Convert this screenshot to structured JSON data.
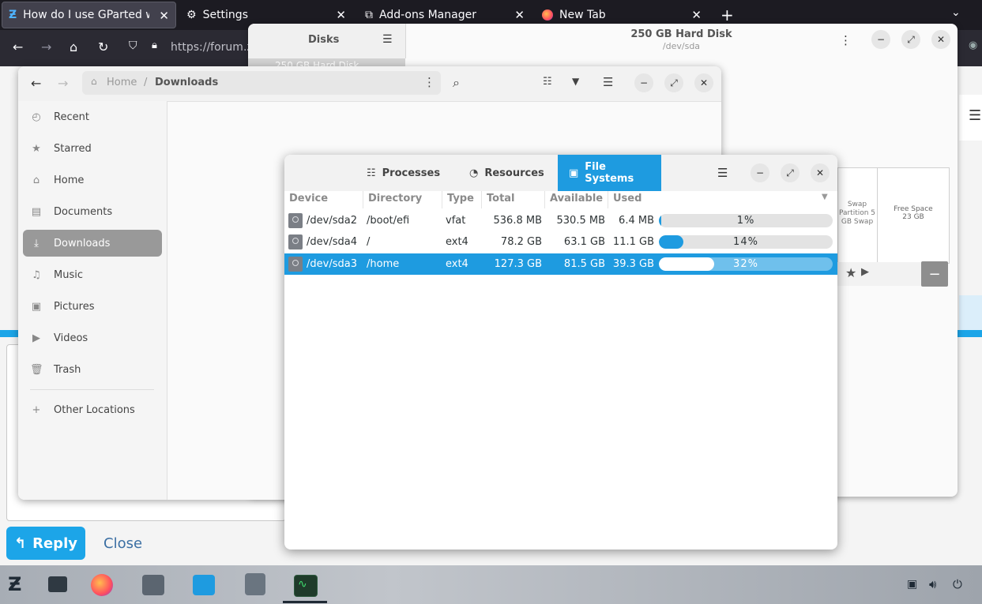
{
  "browser": {
    "tabs": [
      {
        "title": "How do I use GParted with",
        "active": true
      },
      {
        "title": "Settings",
        "active": false
      },
      {
        "title": "Add-ons Manager",
        "active": false
      },
      {
        "title": "New Tab",
        "active": false
      }
    ],
    "new_tab": "+",
    "url": "https://forum.z"
  },
  "webpage": {
    "reply_label": "Reply",
    "close_label": "Close"
  },
  "disks": {
    "sidebar_title": "Disks",
    "drive_item": "250 GB Hard Disk",
    "title": "250 GB Hard Disk",
    "subtitle": "/dev/sda",
    "swap_label": "Swap\nPartition 5\nGB Swap",
    "free_space_label": "Free Space",
    "free_space_size": "23 GB",
    "remove_button": "−"
  },
  "files": {
    "path": {
      "home": "Home",
      "separator": "/",
      "current": "Downloads"
    },
    "sidebar": [
      {
        "label": "Recent",
        "icon": "clock-icon"
      },
      {
        "label": "Starred",
        "icon": "star-icon"
      },
      {
        "label": "Home",
        "icon": "home-icon"
      },
      {
        "label": "Documents",
        "icon": "document-icon"
      },
      {
        "label": "Downloads",
        "icon": "download-icon",
        "selected": true
      },
      {
        "label": "Music",
        "icon": "music-icon"
      },
      {
        "label": "Pictures",
        "icon": "picture-icon"
      },
      {
        "label": "Videos",
        "icon": "video-icon"
      },
      {
        "label": "Trash",
        "icon": "trash-icon"
      }
    ],
    "other_locations": "Other Locations"
  },
  "monitor": {
    "tabs": [
      {
        "label": "Processes",
        "active": false
      },
      {
        "label": "Resources",
        "active": false
      },
      {
        "label": "File Systems",
        "active": true
      }
    ],
    "columns": [
      "Device",
      "Directory",
      "Type",
      "Total",
      "Available",
      "Used"
    ],
    "rows": [
      {
        "device": "/dev/sda2",
        "directory": "/boot/efi",
        "type": "vfat",
        "total": "536.8 MB",
        "available": "530.5 MB",
        "used": "6.4 MB",
        "percent": "1%",
        "fraction": 0.01
      },
      {
        "device": "/dev/sda4",
        "directory": "/",
        "type": "ext4",
        "total": "78.2 GB",
        "available": "63.1 GB",
        "used": "11.1 GB",
        "percent": "14%",
        "fraction": 0.14
      },
      {
        "device": "/dev/sda3",
        "directory": "/home",
        "type": "ext4",
        "total": "127.3 GB",
        "available": "81.5 GB",
        "used": "39.3 GB",
        "percent": "32%",
        "fraction": 0.32,
        "selected": true
      }
    ]
  },
  "colors": {
    "accent": "#1e9be0",
    "browser_bg": "#1c1b22",
    "reply": "#1ca5e8"
  }
}
